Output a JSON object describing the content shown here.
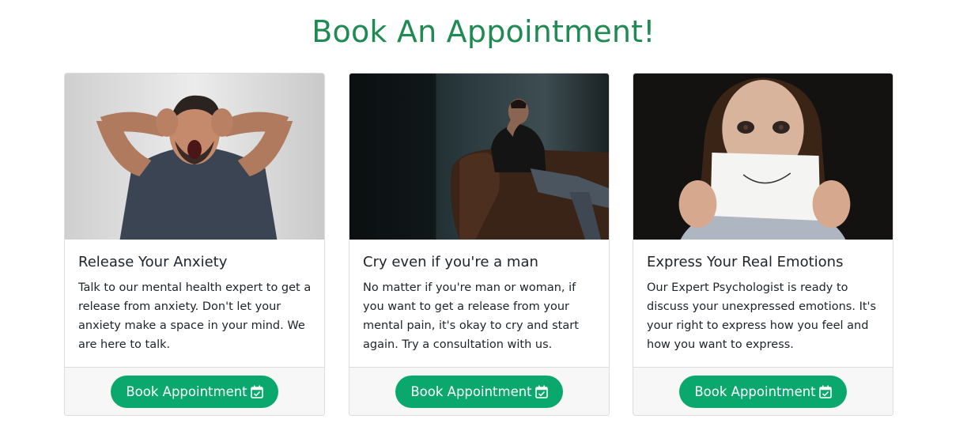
{
  "page": {
    "title": "Book An Appointment!"
  },
  "colors": {
    "title_green": "#1f8a52",
    "button_green": "#0aa86c",
    "footer_bg": "#f7f7f7"
  },
  "cards": [
    {
      "title": "Release Your Anxiety",
      "text": "Talk to our mental health expert to get a release from anxiety. Don't let your anxiety make a space in your mind. We are here to talk.",
      "button_label": "Book Appointment",
      "button_icon": "calendar-check-icon"
    },
    {
      "title": "Cry even if you're a man",
      "text": "No matter if you're man or woman, if you want to get a release from your mental pain, it's okay to cry and start again. Try a consultation with us.",
      "button_label": "Book Appointment",
      "button_icon": "calendar-check-icon"
    },
    {
      "title": "Express Your Real Emotions",
      "text": "Our Expert Psychologist is ready to discuss your unexpressed emotions. It's your right to express how you feel and how you want to express.",
      "button_label": "Book Appointment",
      "button_icon": "calendar-check-icon"
    }
  ]
}
